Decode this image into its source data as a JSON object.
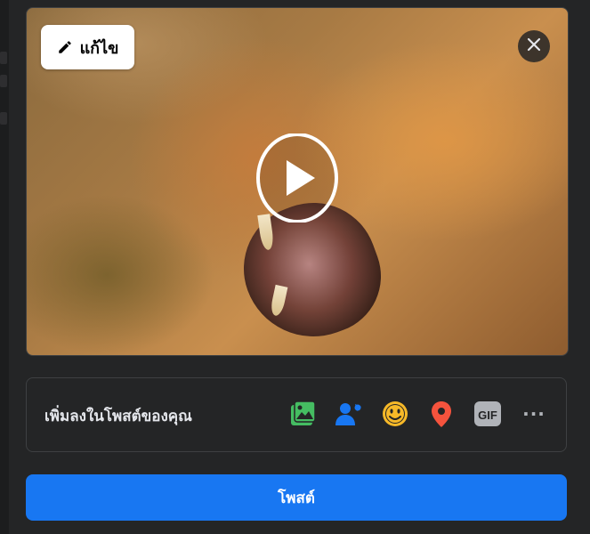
{
  "media": {
    "edit_label": "แก้ไข",
    "edit_icon": "pencil-icon",
    "close_icon": "close-icon",
    "play_icon": "play-icon"
  },
  "add_to_post": {
    "label": "เพิ่มลงในโพสต์ของคุณ",
    "icons": [
      "photo-video-icon",
      "tag-people-icon",
      "feeling-activity-icon",
      "check-in-icon",
      "gif-icon",
      "more-icon"
    ],
    "gif_text": "GIF",
    "more_text": "···"
  },
  "post_button": {
    "label": "โพสต์"
  },
  "colors": {
    "background": "#242526",
    "accent": "#1877f2",
    "photo_green": "#45bd62",
    "tag_blue": "#1877f2",
    "feeling_yellow": "#f7b928",
    "checkin_red": "#f5533d",
    "gif_gray": "#b0b3b8"
  }
}
